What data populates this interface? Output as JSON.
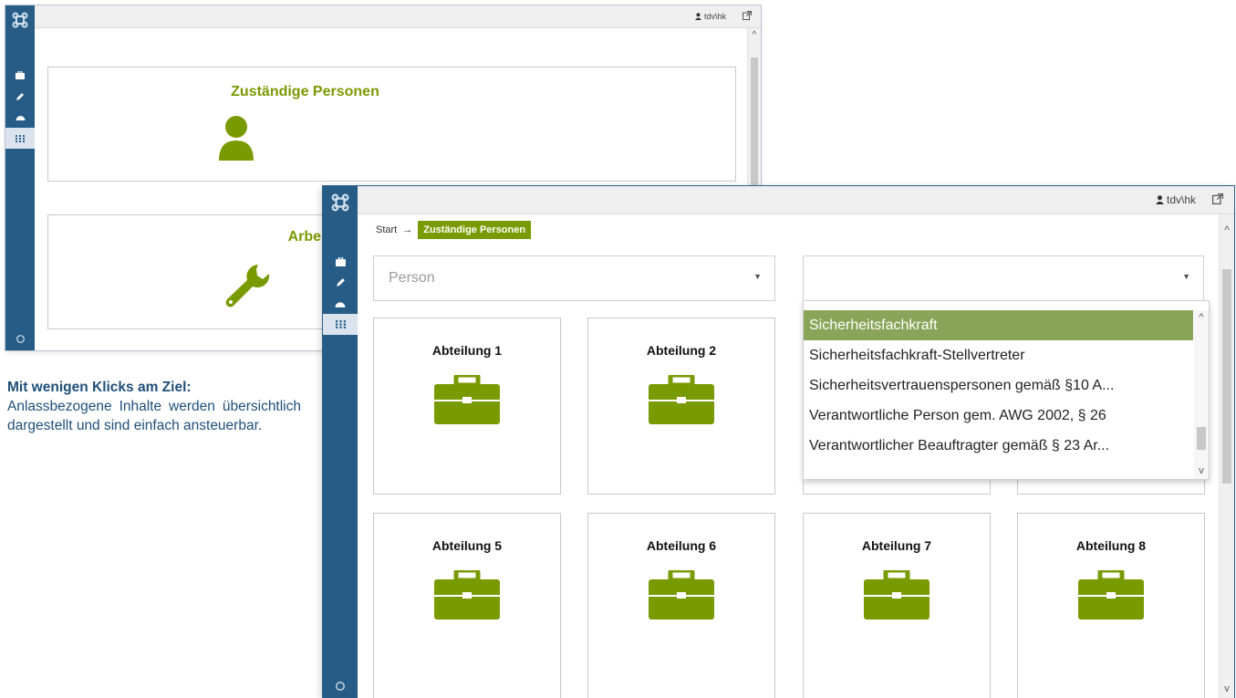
{
  "back_window": {
    "user": "tdv\\hk",
    "cards": [
      {
        "title": "Zuständige Personen",
        "icon": "person-icon"
      },
      {
        "title": "Arbeitsmittel",
        "icon": "wrench-icon"
      }
    ]
  },
  "front_window": {
    "user": "tdv\\hk",
    "breadcrumb": {
      "start": "Start",
      "current": "Zuständige Personen"
    },
    "person_select": {
      "placeholder": "Person"
    },
    "function_select": {
      "value": ""
    },
    "dropdown": {
      "items": [
        "Sicherheitsfachkraft",
        "Sicherheitsfachkraft-Stellvertreter",
        "Sicherheitsvertrauenspersonen gemäß §10 A...",
        "Verantwortliche Person gem. AWG 2002, § 26",
        "Verantwortlicher Beauftragter gemäß § 23 Ar..."
      ],
      "selected_index": 0
    },
    "departments_row1": [
      "Abteilung 1",
      "Abteilung 2"
    ],
    "departments_row2": [
      "Abteilung 5",
      "Abteilung 6",
      "Abteilung 7",
      "Abteilung 8"
    ]
  },
  "caption": {
    "heading": "Mit wenigen Klicks am Ziel:",
    "body": "Anlassbezogene Inhalte werden übersichtlich dargestellt und sind einfach ansteuerbar."
  },
  "colors": {
    "sidebar": "#265c86",
    "accent": "#7a9a01",
    "selected_item": "#8aa55a"
  }
}
